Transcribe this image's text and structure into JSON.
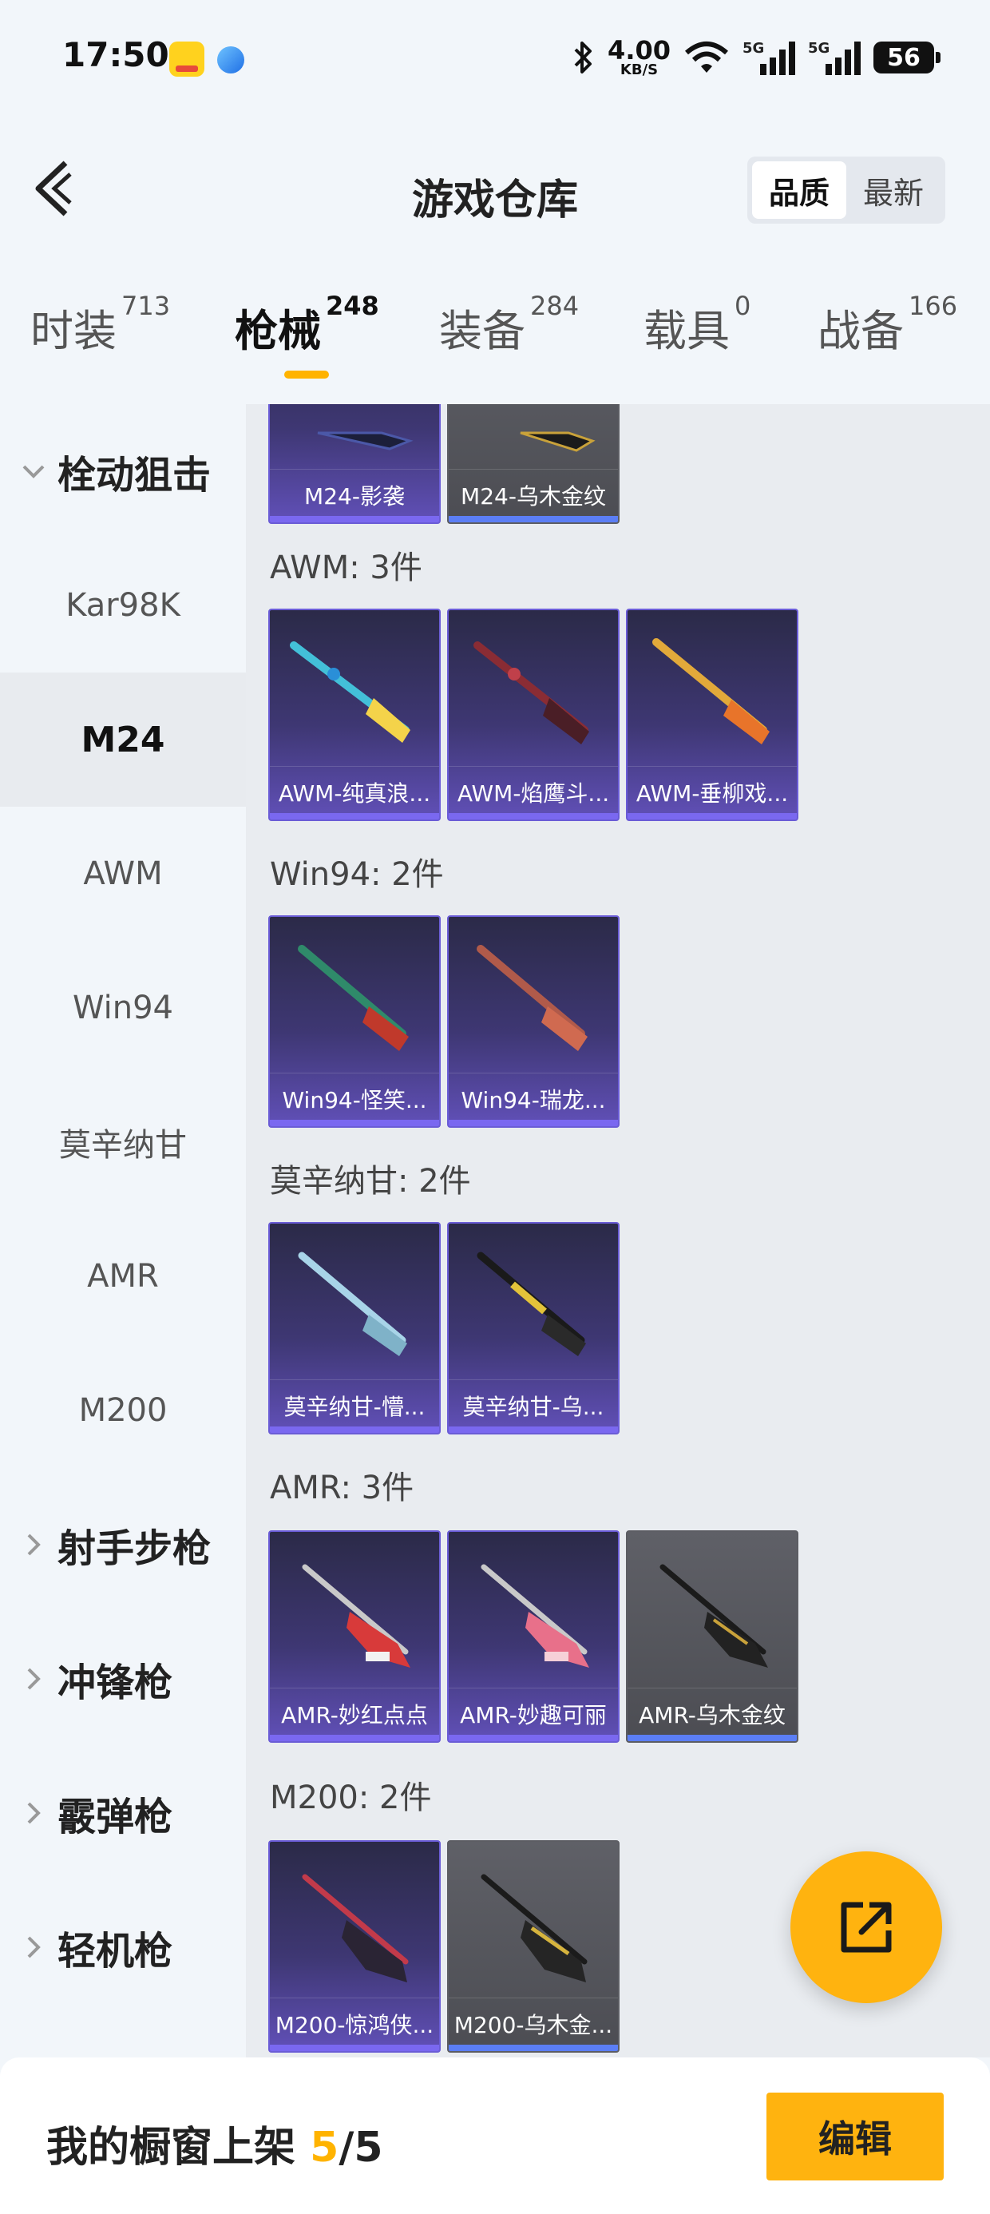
{
  "status_bar": {
    "time": "17:50",
    "net_speed": "4.00",
    "net_unit": "KB/S",
    "signal1_tag": "5G",
    "signal2_tag": "5G",
    "battery": "56"
  },
  "header": {
    "title": "游戏仓库",
    "sort_options": [
      "品质",
      "最新"
    ],
    "active_sort": "品质"
  },
  "tabs": [
    {
      "label": "时装",
      "count": "713"
    },
    {
      "label": "枪械",
      "count": "248"
    },
    {
      "label": "装备",
      "count": "284"
    },
    {
      "label": "载具",
      "count": "0"
    },
    {
      "label": "战备",
      "count": "166"
    }
  ],
  "sidebar": {
    "expanded_category": "栓动狙击",
    "sub_items": [
      "Kar98K",
      "M24",
      "AWM",
      "Win94",
      "莫辛纳甘",
      "AMR",
      "M200"
    ],
    "active_sub": "M24",
    "categories": [
      "射手步枪",
      "冲锋枪",
      "霰弹枪",
      "轻机枪"
    ]
  },
  "groups": [
    {
      "title": "",
      "items": [
        {
          "name": "M24-影袭",
          "tier": "purple"
        },
        {
          "name": "M24-乌木金纹",
          "tier": "gray"
        }
      ]
    },
    {
      "title": "AWM: 3件",
      "items": [
        {
          "name": "AWM-纯真浪...",
          "tier": "purple"
        },
        {
          "name": "AWM-焰鹰斗...",
          "tier": "purple"
        },
        {
          "name": "AWM-垂柳戏...",
          "tier": "purple"
        }
      ]
    },
    {
      "title": "Win94: 2件",
      "items": [
        {
          "name": "Win94-怪笑...",
          "tier": "purple"
        },
        {
          "name": "Win94-瑞龙...",
          "tier": "purple"
        }
      ]
    },
    {
      "title": "莫辛纳甘: 2件",
      "items": [
        {
          "name": "莫辛纳甘-懵...",
          "tier": "purple"
        },
        {
          "name": "莫辛纳甘-乌...",
          "tier": "purple"
        }
      ]
    },
    {
      "title": "AMR: 3件",
      "items": [
        {
          "name": "AMR-妙红点点",
          "tier": "purple"
        },
        {
          "name": "AMR-妙趣可丽",
          "tier": "purple"
        },
        {
          "name": "AMR-乌木金纹",
          "tier": "gray"
        }
      ]
    },
    {
      "title": "M200: 2件",
      "items": [
        {
          "name": "M200-惊鸿侠...",
          "tier": "purple"
        },
        {
          "name": "M200-乌木金...",
          "tier": "gray"
        }
      ]
    }
  ],
  "bottom": {
    "label": "我的橱窗上架",
    "current": "5",
    "separator": "/",
    "max": "5",
    "edit_label": "编辑"
  },
  "colors": {
    "accent": "#ffb30f",
    "purple_tier": "#6a5cd6",
    "gray_tier": "#5c5d63"
  }
}
